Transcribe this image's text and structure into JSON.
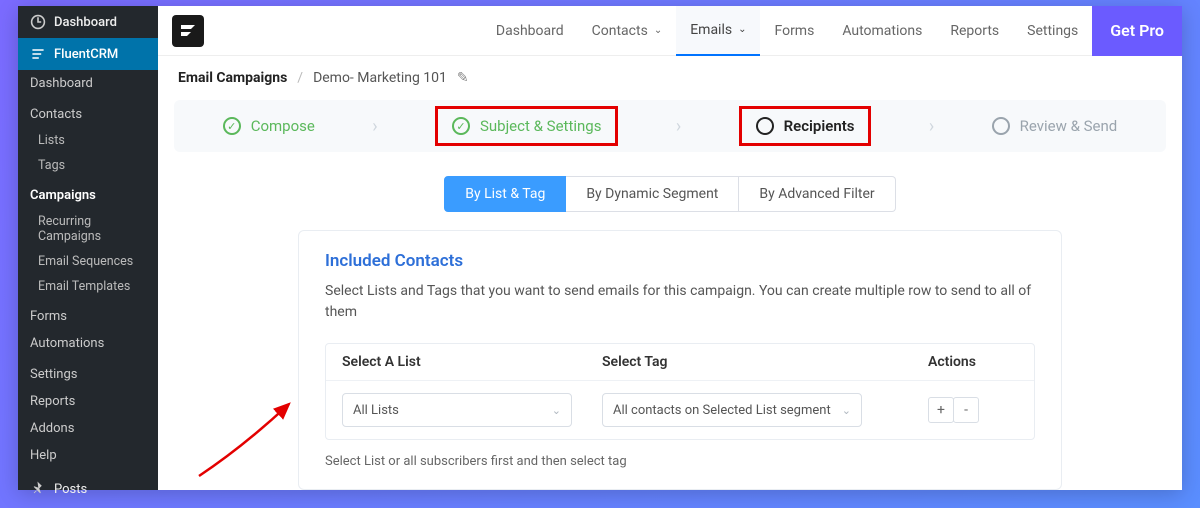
{
  "wp_sidebar": {
    "dashboard": "Dashboard",
    "active": "FluentCRM",
    "items": [
      "Dashboard",
      "Contacts",
      "Lists",
      "Tags",
      "Campaigns",
      "Recurring Campaigns",
      "Email Sequences",
      "Email Templates",
      "Forms",
      "Automations",
      "Settings",
      "Reports",
      "Addons",
      "Help"
    ],
    "posts": "Posts"
  },
  "topnav": {
    "links": [
      "Dashboard",
      "Contacts",
      "Emails",
      "Forms",
      "Automations",
      "Reports",
      "Settings"
    ],
    "getpro": "Get Pro"
  },
  "breadcrumb": {
    "root": "Email Campaigns",
    "current": "Demo- Marketing 101"
  },
  "steps": {
    "compose": "Compose",
    "subject": "Subject & Settings",
    "recipients": "Recipients",
    "review": "Review & Send"
  },
  "seg_tabs": {
    "list": "By List & Tag",
    "dynamic": "By Dynamic Segment",
    "advanced": "By Advanced Filter"
  },
  "card": {
    "title": "Included Contacts",
    "desc": "Select Lists and Tags that you want to send emails for this campaign. You can create multiple row to send to all of them",
    "col_list": "Select A List",
    "col_tag": "Select Tag",
    "col_actions": "Actions",
    "val_list": "All Lists",
    "val_tag": "All contacts on Selected List segment",
    "hint": "Select List or all subscribers first and then select tag"
  }
}
